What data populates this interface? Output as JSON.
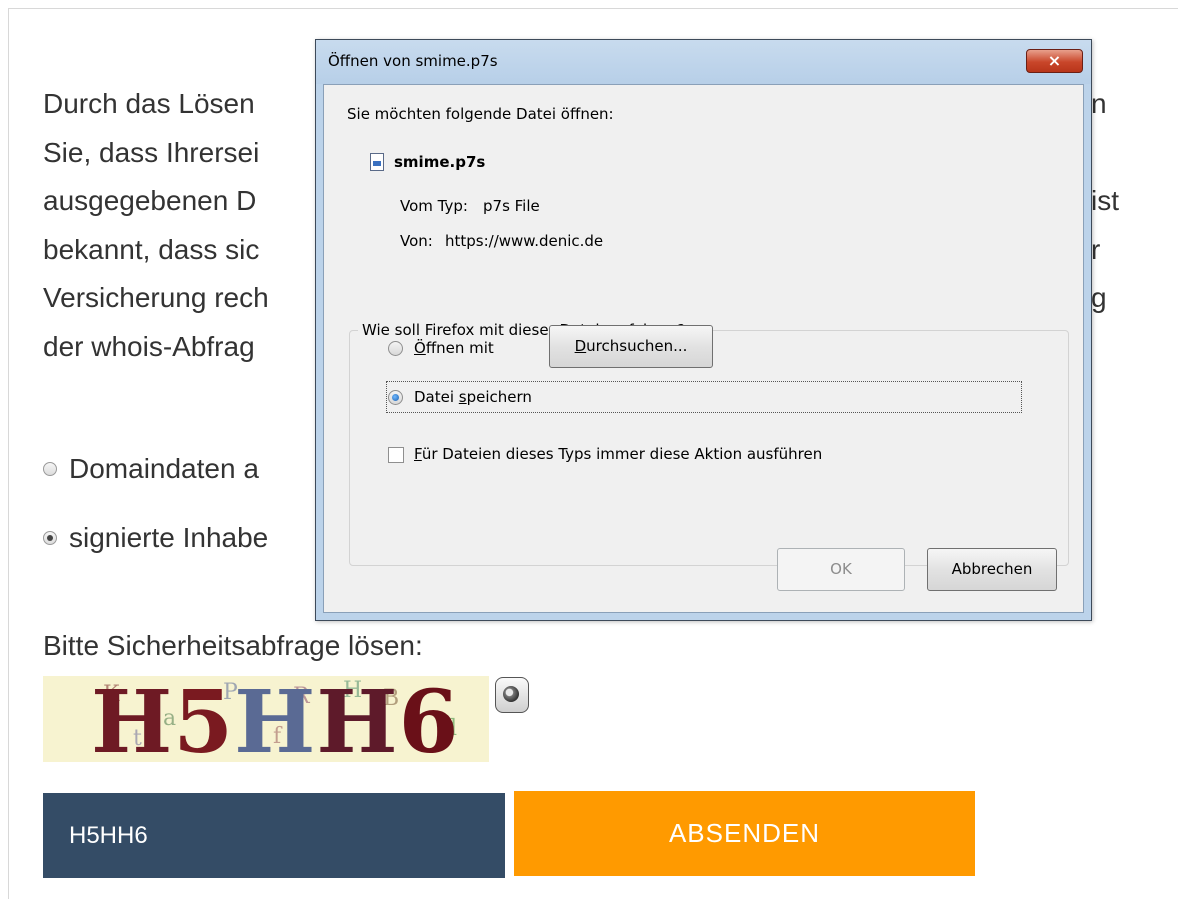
{
  "page": {
    "intro_lines": [
      "Durch das Lösen",
      "Sie, dass Ihrersei",
      "ausgegebenen D",
      "bekannt, dass sic",
      "Versicherung rech",
      "der whois-Abfrag"
    ],
    "intro_right_fragments": [
      "n",
      "ist",
      "r",
      "g"
    ],
    "options": [
      {
        "label": "Domaindaten a",
        "checked": false
      },
      {
        "label": "signierte Inhabe",
        "checked": true
      }
    ],
    "captcha_label": "Bitte Sicherheitsabfrage lösen:",
    "captcha_image_text": "H5HH6",
    "captcha_input_value": "H5HH6",
    "submit_label": "ABSENDEN",
    "colors": {
      "input_bg": "#344c66",
      "submit_bg": "#ff9a00"
    }
  },
  "dialog": {
    "title": "Öffnen von smime.p7s",
    "close_icon": "×",
    "prompt": "Sie möchten folgende Datei öffnen:",
    "file_name": "smime.p7s",
    "type_label": "Vom Typ:",
    "type_value": "p7s File",
    "from_label": "Von:",
    "from_value": "https://www.denic.de",
    "group_title": "Wie soll Firefox mit dieser Datei verfahren?",
    "open_with": {
      "rest": "ffnen mit",
      "key": "Ö",
      "checked": false
    },
    "browse_button": {
      "key": "D",
      "rest": "urchsuchen..."
    },
    "save_file": {
      "pre": "Datei ",
      "key": "s",
      "rest": "peichern",
      "checked": true
    },
    "always": {
      "key": "F",
      "rest": "ür Dateien dieses Typs immer diese Aktion ausführen",
      "checked": false
    },
    "ok_label": "OK",
    "cancel_label": "Abbrechen"
  }
}
